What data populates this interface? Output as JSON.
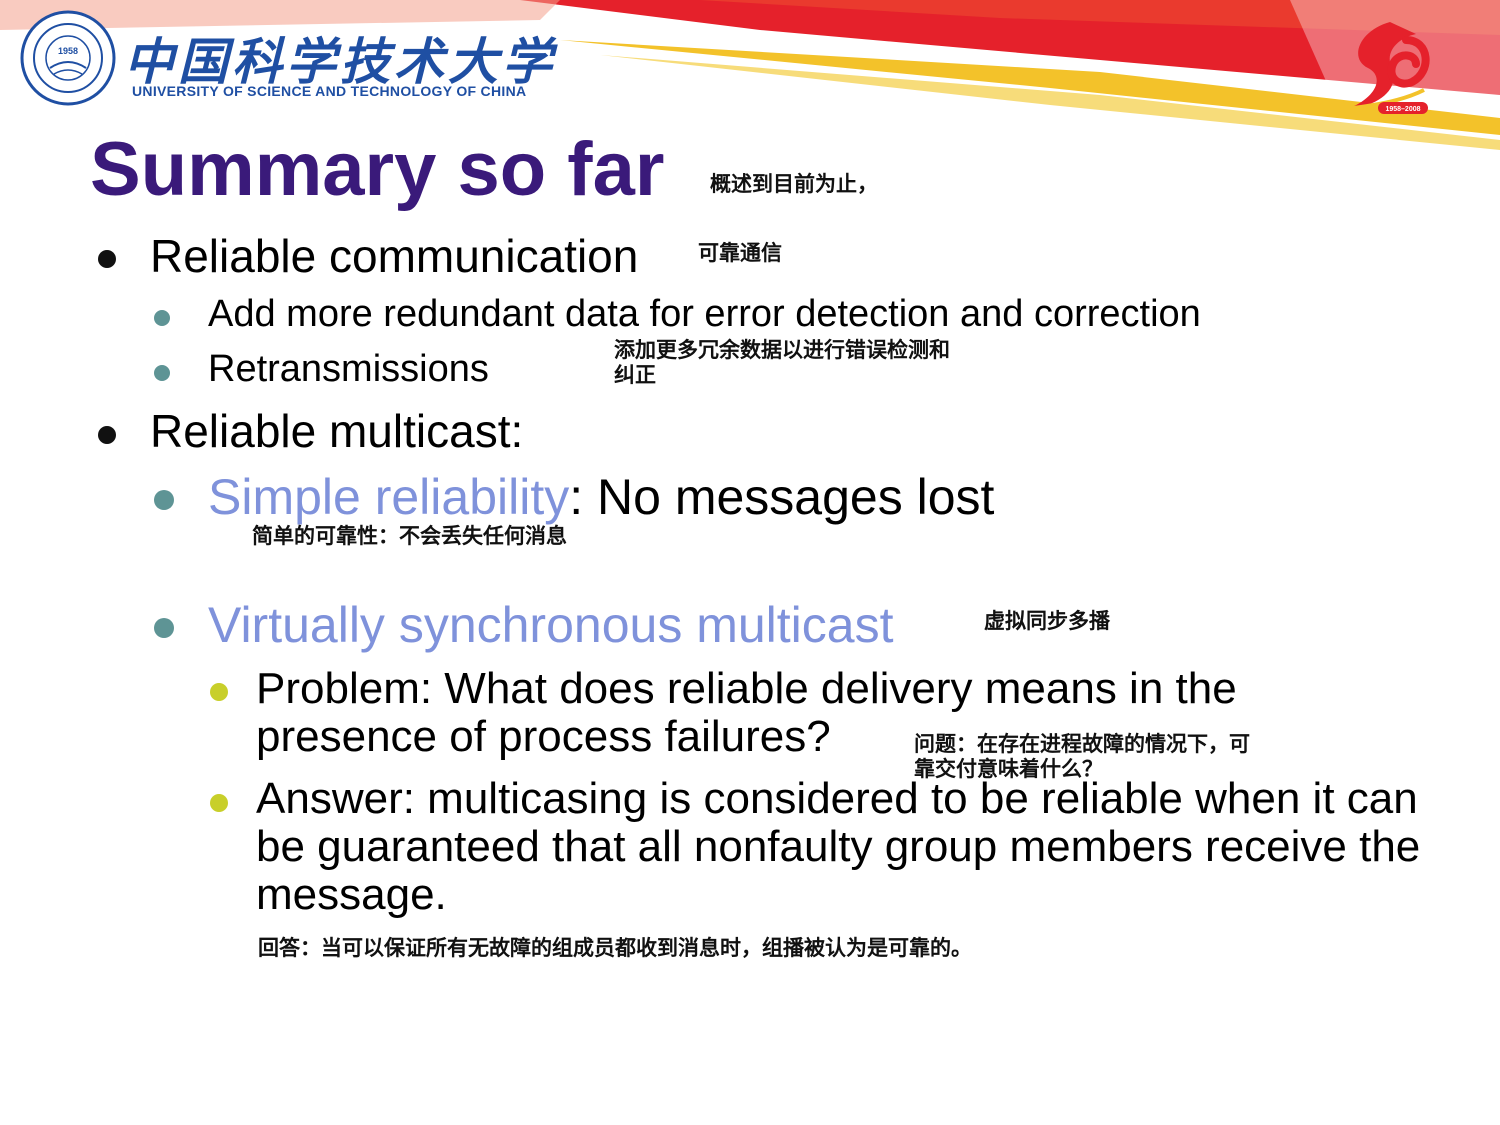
{
  "header": {
    "university_cn": "中国科学技术大学",
    "university_en": "UNIVERSITY OF SCIENCE AND TECHNOLOGY OF CHINA",
    "emblem_year": "1958",
    "anniversary_years": "1958–2008",
    "colors": {
      "brand_blue": "#1f4fa3",
      "band_red": "#e5212b",
      "band_yellow": "#f3c22a"
    }
  },
  "slide": {
    "title": "Summary so far",
    "title_note": "概述到目前为止，",
    "colors": {
      "title": "#3a1a7a",
      "highlight": "#7f92db",
      "bullet_l2": "#5e9495",
      "bullet_l3": "#c8cf2a"
    },
    "items": [
      {
        "text": "Reliable communication",
        "note": "可靠通信",
        "sub": [
          {
            "text": "Add more redundant data for error detection and correction"
          },
          {
            "text": "Retransmissions"
          }
        ],
        "sub_note_line1": "添加更多冗余数据以进行错误检测和",
        "sub_note_line2": "纠正"
      },
      {
        "text": "Reliable multicast:",
        "sub": [
          {
            "highlight": "Simple reliability",
            "text": ": No messages lost",
            "note": "简单的可靠性：不会丢失任何消息"
          },
          {
            "highlight": "Virtually synchronous multicast",
            "note": "虚拟同步多播",
            "sub": [
              {
                "text": "Problem: What does reliable delivery means in the presence of process failures?",
                "note_line1": "问题：在存在进程故障的情况下，可",
                "note_line2": "靠交付意味着什么？"
              },
              {
                "text": "Answer: multicasing is considered to be reliable when it can be guaranteed that all nonfaulty group members receive the message.",
                "note": "回答：当可以保证所有无故障的组成员都收到消息时，组播被认为是可靠的。"
              }
            ]
          }
        ]
      }
    ]
  }
}
